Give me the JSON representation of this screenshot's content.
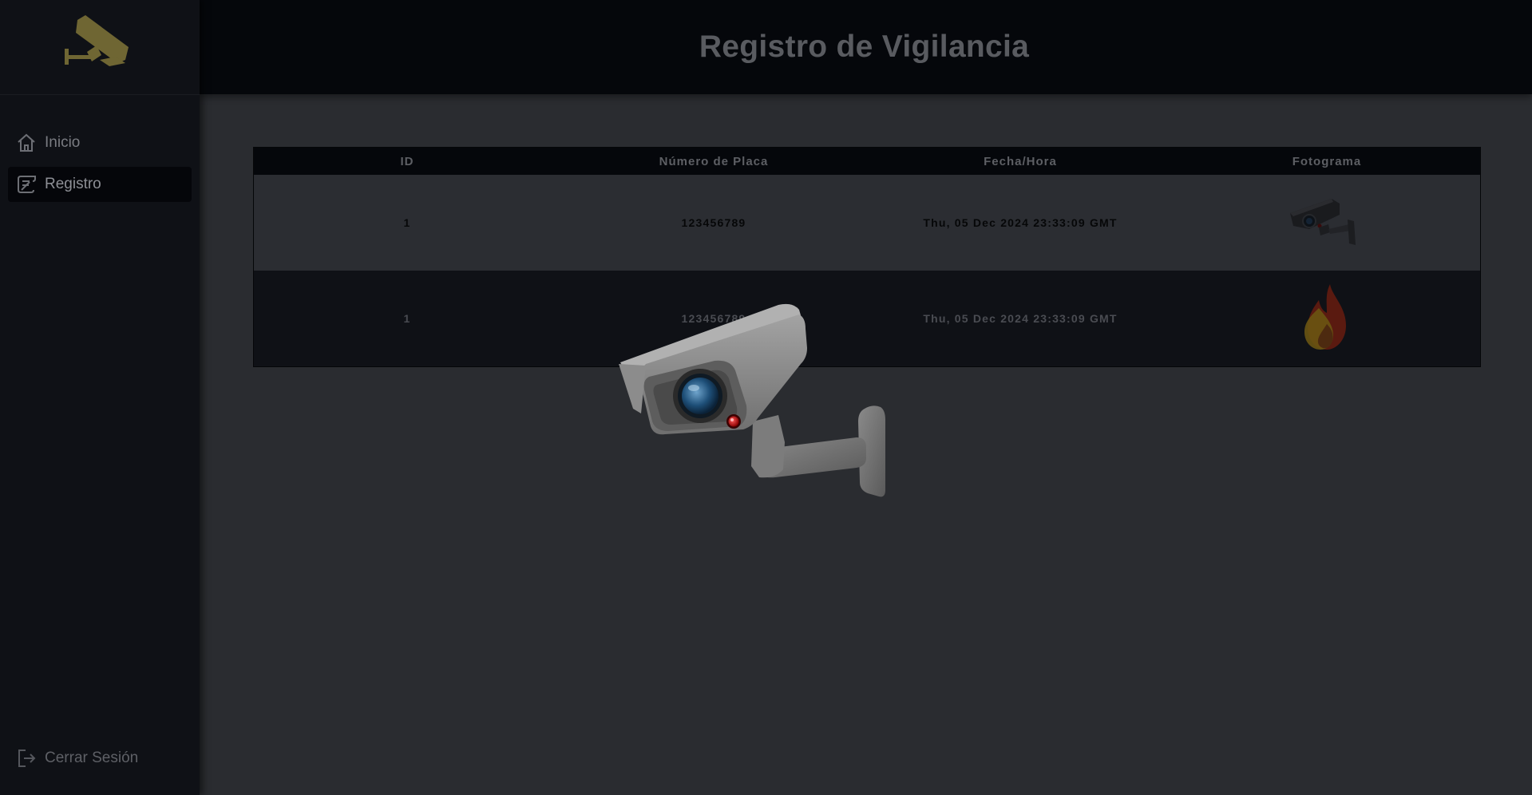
{
  "sidebar": {
    "logo_icon": "security-camera-logo",
    "items": [
      {
        "label": "Inicio",
        "icon": "home-icon",
        "active": false
      },
      {
        "label": "Registro",
        "icon": "register-icon",
        "active": true
      }
    ],
    "logout_label": "Cerrar Sesión",
    "logout_icon": "logout-icon"
  },
  "header": {
    "title": "Registro de Vigilancia"
  },
  "table": {
    "columns": [
      "ID",
      "Número de Placa",
      "Fecha/Hora",
      "Fotograma"
    ],
    "rows": [
      {
        "id": "1",
        "plate": "123456789",
        "datetime": "Thu, 05 Dec 2024 23:33:09 GMT",
        "frame_icon": "camera-thumbnail"
      },
      {
        "id": "1",
        "plate": "123456789",
        "datetime": "Thu, 05 Dec 2024 23:33:09 GMT",
        "frame_icon": "flame-thumbnail"
      }
    ]
  },
  "overlay": {
    "icon": "security-camera-overlay"
  },
  "colors": {
    "background": "#2a2c30",
    "sidebar": "#0f1116",
    "header": "#05070b",
    "logo_accent": "#6f6633",
    "camera_body": "#8a8a8a"
  }
}
